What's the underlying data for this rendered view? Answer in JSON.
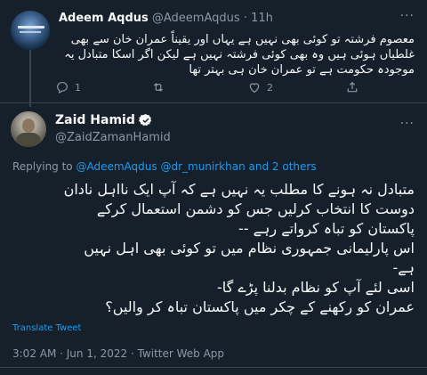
{
  "reply": {
    "author_name": "Adeem Aqdus",
    "author_handle": "@AdeemAqdus",
    "separator": "·",
    "time": "11h",
    "more": "···",
    "text": "معصوم فرشتہ تو کوئی بھی نہیں ہے یہاں اور یقیناً عمران خان سے بھی غلطیاں ہوئی ہیں وہ بھی کوئی فرشتہ نہیں ہے لیکن اگر اسکا متبادل یہ موجودہ حکومت ہے تو عمران خان ہی بہتر تھا",
    "actions": {
      "reply_count": "1",
      "retweet_count": "",
      "like_count": "2"
    }
  },
  "tweet": {
    "author_name": "Zaid Hamid",
    "author_handle": "@ZaidZamanHamid",
    "replying_prefix": "Replying to",
    "replying_users": "@AdeemAqdus @dr_munirkhan",
    "replying_suffix": "and 2 others",
    "lines": [
      "متبادل نہ ہونے کا مطلب یہ نہیں ہے کہ آپ ایک نااہل نادان",
      "دوست کا انتخاب کرلیں جس کو دشمن استعمال کرکے",
      "پاکستان کو تباہ کرواتے رہے --",
      "اس پارلیمانی جمہوری نظام میں تو کوئی بھی اہل نہیں",
      "ہے-",
      "اسی لئے آپ کو نظام بدلنا پڑے گا-",
      "عمران کو رکھنے کے چکر میں پاکستان تباہ کر والیں؟"
    ],
    "translate_label": "Translate Tweet",
    "timestamp": "3:02 AM · Jun 1, 2022 · Twitter Web App"
  },
  "colors": {
    "background": "#15202b",
    "accent": "#1d9bf0",
    "muted": "#8b98a5",
    "text": "#f7f9f9"
  }
}
